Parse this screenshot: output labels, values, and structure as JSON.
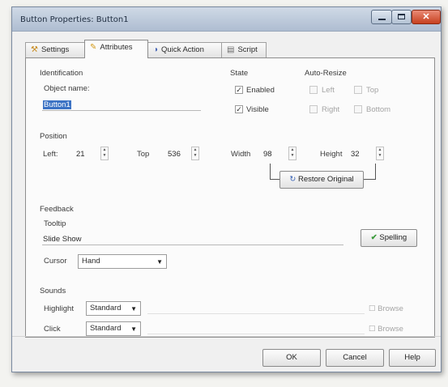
{
  "window": {
    "title": "Button Properties: Button1"
  },
  "tabs": [
    {
      "label": "Settings",
      "icon": "settings-wrench-icon"
    },
    {
      "label": "Attributes",
      "icon": "attributes-tag-icon"
    },
    {
      "label": "Quick Action",
      "icon": "quick-action-icon"
    },
    {
      "label": "Script",
      "icon": "script-icon"
    }
  ],
  "identification": {
    "heading": "Identification",
    "object_name_label": "Object name:",
    "object_name_value": "Button1"
  },
  "state": {
    "heading": "State",
    "enabled_label": "Enabled",
    "enabled_checked": true,
    "visible_label": "Visible",
    "visible_checked": true
  },
  "auto_resize": {
    "heading": "Auto-Resize",
    "left_label": "Left",
    "top_label": "Top",
    "right_label": "Right",
    "bottom_label": "Bottom"
  },
  "position": {
    "heading": "Position",
    "left_label": "Left:",
    "left_value": "21",
    "top_label": "Top",
    "top_value": "536",
    "width_label": "Width",
    "width_value": "98",
    "height_label": "Height",
    "height_value": "32",
    "restore_label": "Restore Original"
  },
  "feedback": {
    "heading": "Feedback",
    "tooltip_label": "Tooltip",
    "tooltip_value": "Slide Show",
    "spelling_label": "Spelling",
    "cursor_label": "Cursor",
    "cursor_value": "Hand"
  },
  "sounds": {
    "heading": "Sounds",
    "highlight_label": "Highlight",
    "highlight_value": "Standard",
    "click_label": "Click",
    "click_value": "Standard",
    "browse_label": "Browse"
  },
  "footer": {
    "ok": "OK",
    "cancel": "Cancel",
    "help": "Help"
  },
  "colors": {
    "selection": "#3b72c4",
    "close_button": "#c7401f",
    "titlebar": "#aebdd1"
  }
}
